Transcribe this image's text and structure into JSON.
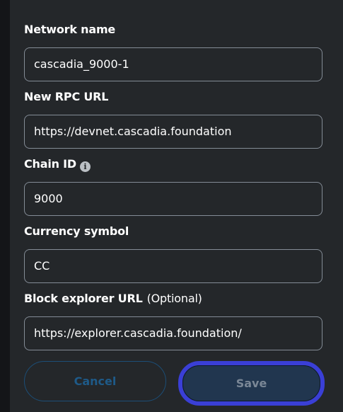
{
  "form": {
    "network_name": {
      "label": "Network name",
      "value": "cascadia_9000-1"
    },
    "rpc_url": {
      "label": "New RPC URL",
      "value": "https://devnet.cascadia.foundation"
    },
    "chain_id": {
      "label": "Chain ID",
      "value": "9000",
      "info_icon": "i"
    },
    "currency_symbol": {
      "label": "Currency symbol",
      "value": "CC"
    },
    "block_explorer": {
      "label": "Block explorer URL",
      "optional": "(Optional)",
      "value": "https://explorer.cascadia.foundation/"
    }
  },
  "actions": {
    "cancel_label": "Cancel",
    "save_label": "Save"
  },
  "colors": {
    "background": "#24272a",
    "text": "#ffffff",
    "border": "#848c96",
    "focus_ring": "#3a3fd6",
    "cancel_text": "#1e5a88"
  }
}
